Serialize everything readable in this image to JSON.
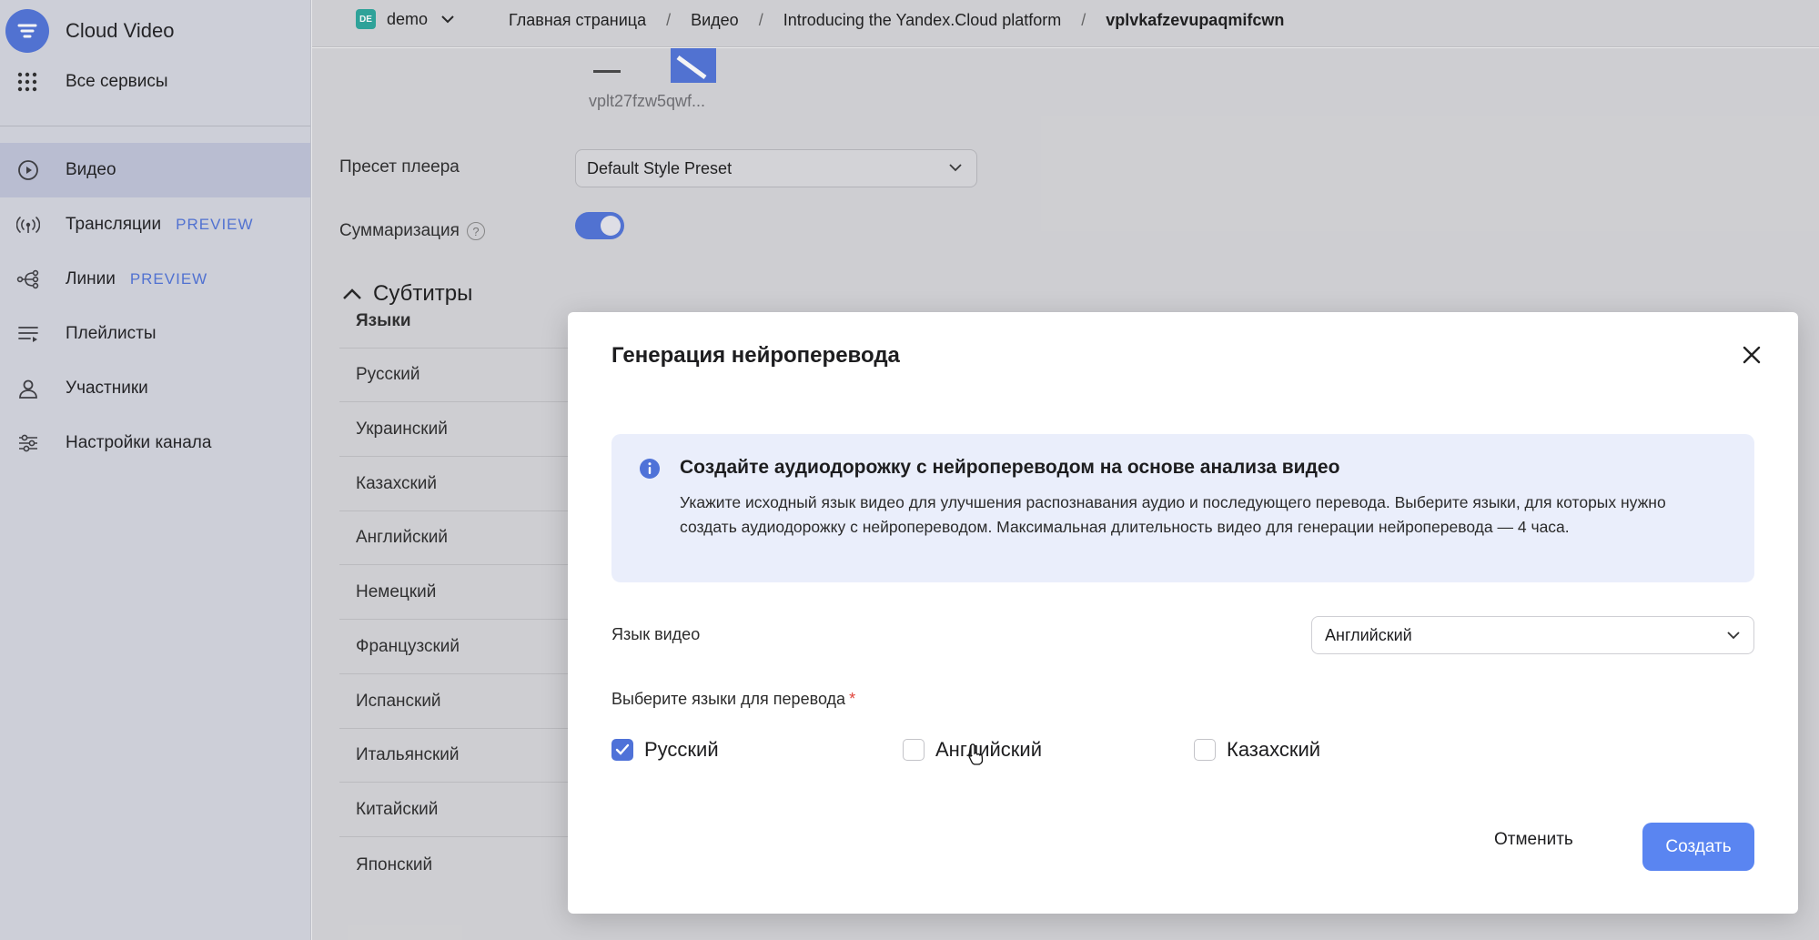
{
  "app": {
    "name": "Cloud Video",
    "all_services": "Все сервисы"
  },
  "sidebar": {
    "items": [
      {
        "label": "Видео",
        "badge": ""
      },
      {
        "label": "Трансляции",
        "badge": "PREVIEW"
      },
      {
        "label": "Линии",
        "badge": "PREVIEW"
      },
      {
        "label": "Плейлисты",
        "badge": ""
      },
      {
        "label": "Участники",
        "badge": ""
      },
      {
        "label": "Настройки канала",
        "badge": ""
      }
    ]
  },
  "header": {
    "folder_badge": "DE",
    "folder": "demo",
    "breadcrumbs": [
      "Главная страница",
      "Видео",
      "Introducing the Yandex.Cloud platform",
      "vplvkafzevupaqmifcwn"
    ]
  },
  "main": {
    "thumb_caption": "vplt27fzw5qwf...",
    "preset_label": "Пресет плеера",
    "preset_value": "Default Style Preset",
    "summary_label": "Суммаризация",
    "help_glyph": "?",
    "subtitles_heading": "Субтитры",
    "languages_header": "Языки",
    "languages": [
      "Русский",
      "Украинский",
      "Казахский",
      "Английский",
      "Немецкий",
      "Французский",
      "Испанский",
      "Итальянский",
      "Китайский",
      "Японский"
    ]
  },
  "modal": {
    "title": "Генерация нейроперевода",
    "info_title": "Создайте аудиодорожку с нейропереводом на основе анализа видео",
    "info_body": "Укажите исходный язык видео для улучшения распознавания аудио и последующего перевода. Выберите языки, для которых нужно создать аудиодорожку с нейропереводом. Максимальная длительность видео для генерации нейроперевода — 4 часа.",
    "video_lang_label": "Язык видео",
    "video_lang_value": "Английский",
    "translate_label": "Выберите языки для перевода",
    "required_mark": "*",
    "options": [
      {
        "label": "Русский",
        "checked": true
      },
      {
        "label": "Английский",
        "checked": false
      },
      {
        "label": "Казахский",
        "checked": false
      }
    ],
    "cancel": "Отменить",
    "create": "Создать"
  },
  "colors": {
    "accent": "#4f72d8",
    "button": "#5a85f1",
    "required": "#e0433a"
  }
}
